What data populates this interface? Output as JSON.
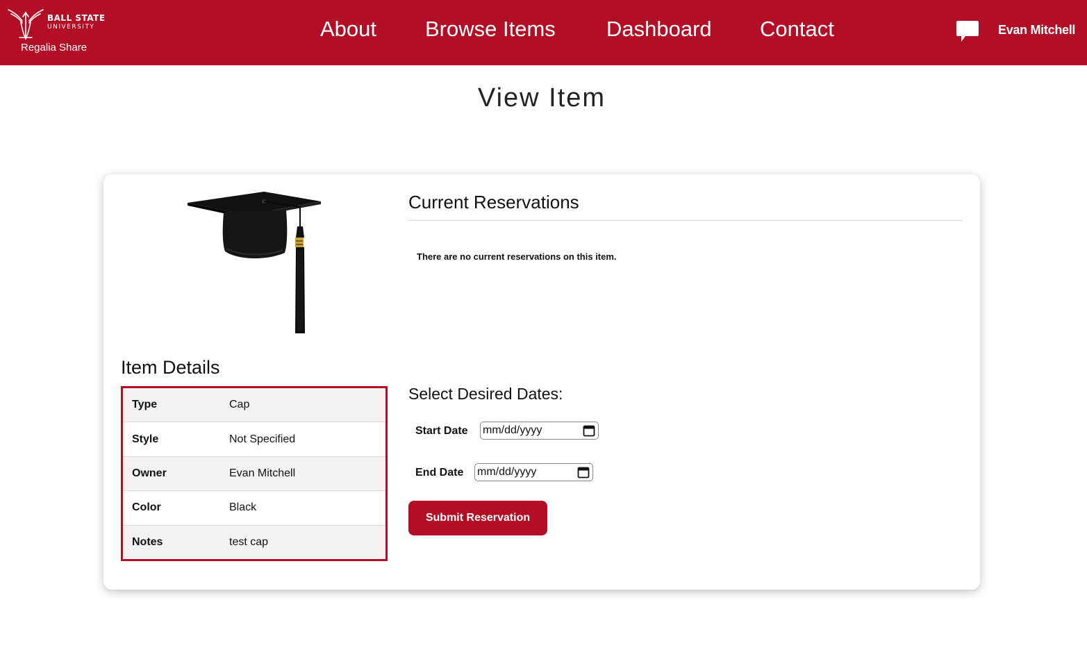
{
  "brand": {
    "university_line1": "BALL STATE",
    "university_line2": "UNIVERSITY",
    "app_name": "Regalia Share"
  },
  "nav": {
    "items": [
      {
        "label": "About"
      },
      {
        "label": "Browse Items"
      },
      {
        "label": "Dashboard"
      },
      {
        "label": "Contact"
      }
    ],
    "chat_icon": "chat-bubble-icon",
    "user_name": "Evan Mitchell"
  },
  "page": {
    "title": "View Item"
  },
  "item": {
    "image_icon": "graduation-cap-image",
    "details_heading": "Item Details",
    "details": [
      {
        "key": "Type",
        "value": "Cap"
      },
      {
        "key": "Style",
        "value": "Not Specified"
      },
      {
        "key": "Owner",
        "value": "Evan Mitchell"
      },
      {
        "key": "Color",
        "value": "Black"
      },
      {
        "key": "Notes",
        "value": "test cap"
      }
    ]
  },
  "reservations": {
    "heading": "Current Reservations",
    "empty_message": "There are no current reservations on this item."
  },
  "dates": {
    "heading": "Select Desired Dates:",
    "start_label": "Start Date",
    "start_placeholder": "mm/dd/yyyy",
    "end_label": "End Date",
    "end_placeholder": "mm/dd/yyyy",
    "calendar_icon": "calendar-icon",
    "submit_label": "Submit Reservation"
  },
  "colors": {
    "brand_red": "#b20f26",
    "white": "#ffffff"
  }
}
